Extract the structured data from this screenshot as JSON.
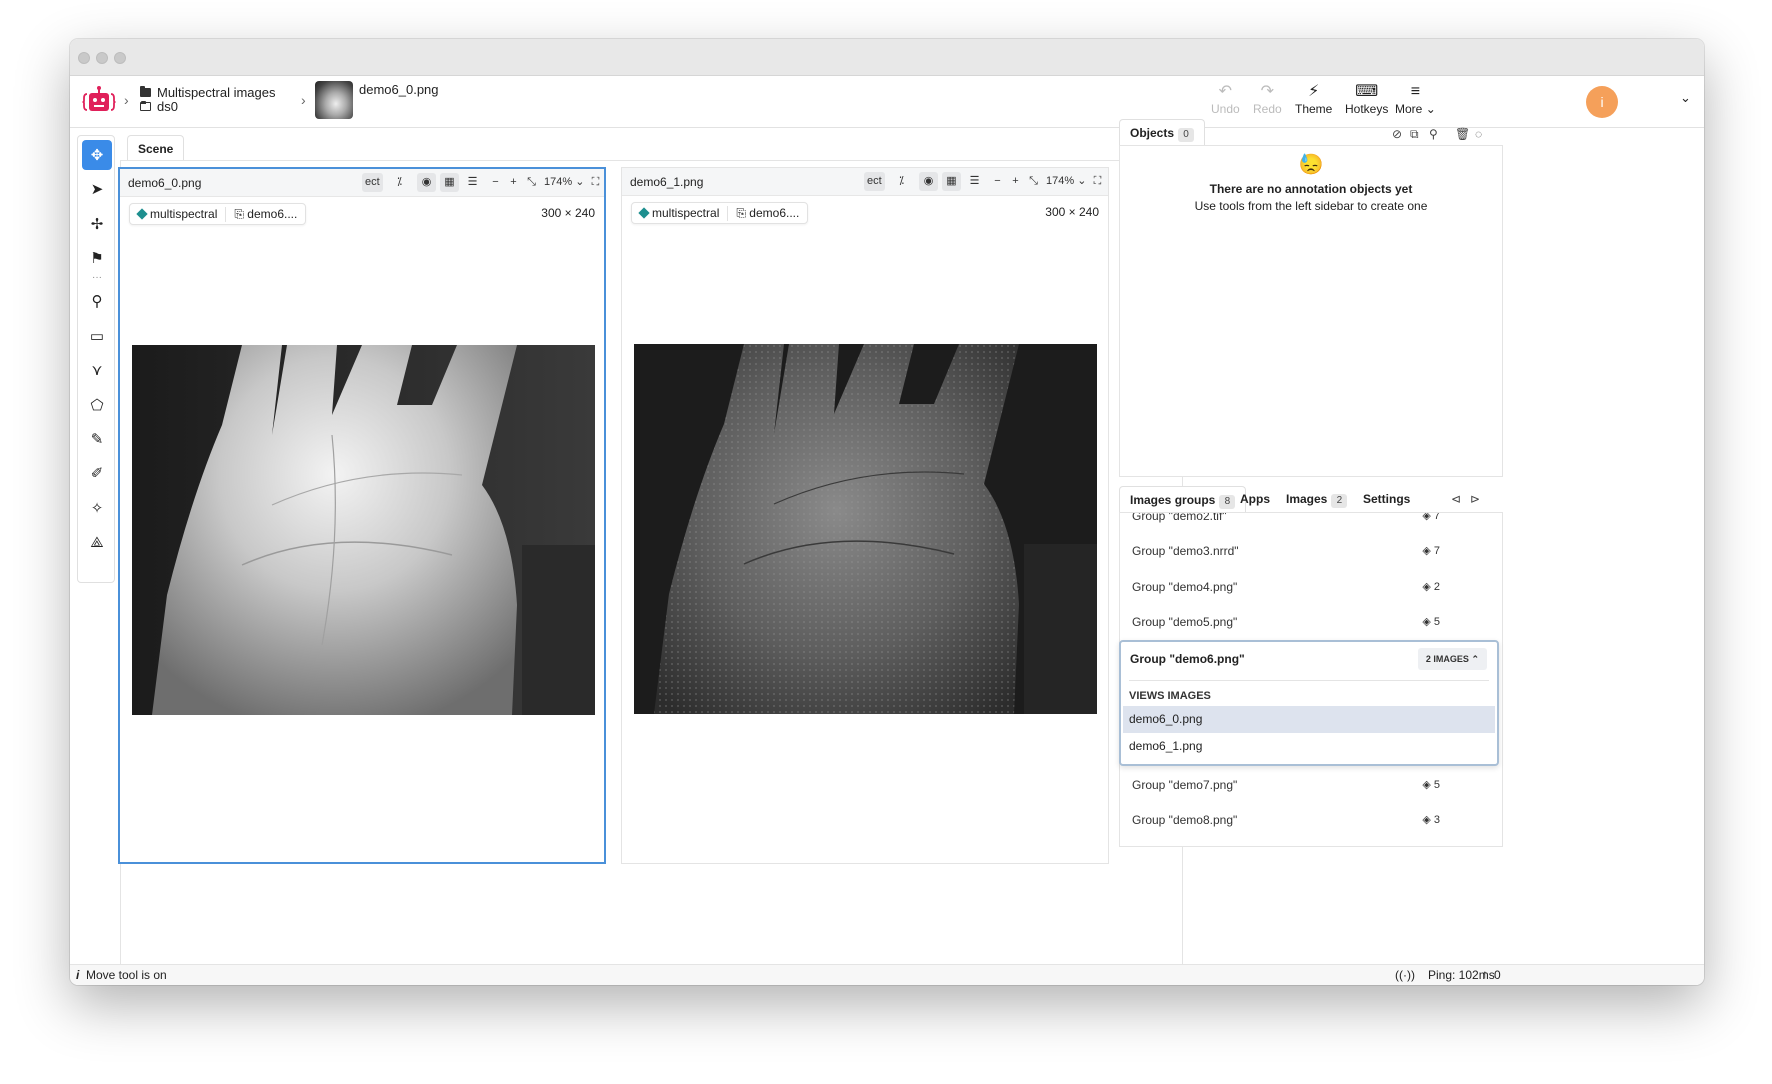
{
  "breadcrumb": {
    "project": "Multispectral images",
    "dataset": "ds0",
    "image": "demo6_0.png"
  },
  "header_tools": {
    "undo": "Undo",
    "redo": "Redo",
    "theme": "Theme",
    "hotkeys": "Hotkeys",
    "more": "More",
    "avatar_initial": "i"
  },
  "scene": {
    "tab": "Scene",
    "viewers": [
      {
        "name": "demo6_0.png",
        "mode": "ect",
        "zoom": "174%",
        "tag": "multispectral",
        "file": "demo6....",
        "dims": "300 × 240"
      },
      {
        "name": "demo6_1.png",
        "mode": "ect",
        "zoom": "174%",
        "tag": "multispectral",
        "file": "demo6....",
        "dims": "300 × 240"
      }
    ]
  },
  "objects": {
    "tab": "Objects",
    "count": "0",
    "empty_emoji": "😓",
    "empty_title": "There are no annotation objects yet",
    "empty_hint": "Use tools from the left sidebar to create one"
  },
  "bottom_tabs": {
    "images_groups": "Images groups",
    "images_groups_count": "8",
    "apps": "Apps",
    "images": "Images",
    "images_count": "2",
    "settings": "Settings"
  },
  "groups": {
    "partial": {
      "name": "Group \"demo2.tif\"",
      "count": "7"
    },
    "before": [
      {
        "name": "Group \"demo3.nrrd\"",
        "count": "7"
      },
      {
        "name": "Group \"demo4.png\"",
        "count": "2"
      },
      {
        "name": "Group \"demo5.png\"",
        "count": "5"
      }
    ],
    "open": {
      "name": "Group \"demo6.png\"",
      "badge": "2 IMAGES",
      "section": "VIEWS IMAGES",
      "images": [
        "demo6_0.png",
        "demo6_1.png"
      ]
    },
    "after": [
      {
        "name": "Group \"demo7.png\"",
        "count": "5"
      },
      {
        "name": "Group \"demo8.png\"",
        "count": "3"
      }
    ]
  },
  "status": {
    "left": "Move tool is on",
    "ping": "Ping: 102ms",
    "uploads": "0"
  },
  "colors": {
    "accent": "#3a8be8",
    "logo": "#e0205a",
    "avatar": "#f5a05a",
    "tag": "#1d8f8f"
  }
}
